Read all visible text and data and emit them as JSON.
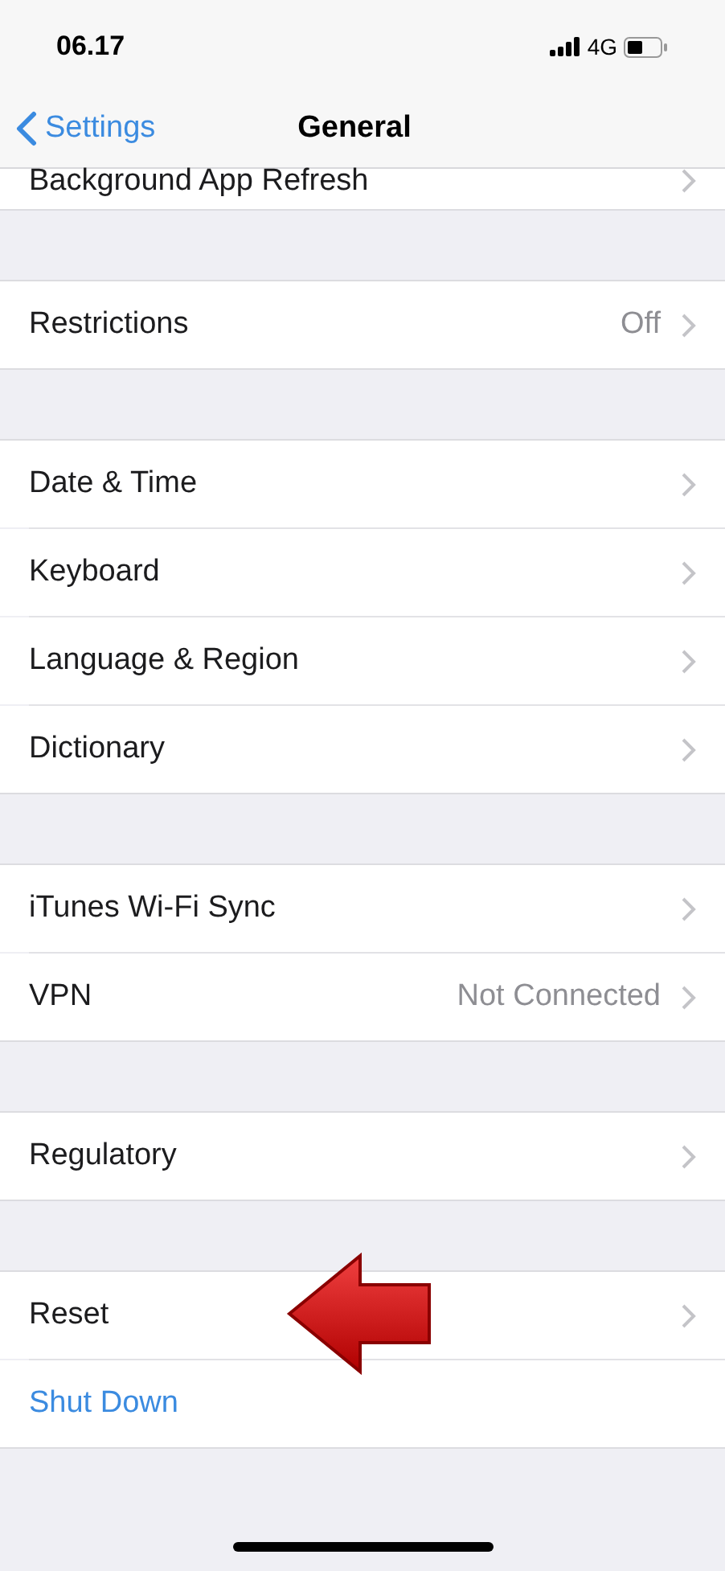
{
  "status_bar": {
    "time": "06.17",
    "network": "4G"
  },
  "nav": {
    "back": "Settings",
    "title": "General"
  },
  "groups": [
    {
      "partial": true,
      "rows": [
        {
          "label": "Background App Refresh",
          "kind": "nav"
        }
      ]
    },
    {
      "rows": [
        {
          "label": "Restrictions",
          "value": "Off",
          "kind": "nav"
        }
      ]
    },
    {
      "rows": [
        {
          "label": "Date & Time",
          "kind": "nav"
        },
        {
          "label": "Keyboard",
          "kind": "nav"
        },
        {
          "label": "Language & Region",
          "kind": "nav"
        },
        {
          "label": "Dictionary",
          "kind": "nav"
        }
      ]
    },
    {
      "rows": [
        {
          "label": "iTunes Wi-Fi Sync",
          "kind": "nav"
        },
        {
          "label": "VPN",
          "value": "Not Connected",
          "kind": "nav"
        }
      ]
    },
    {
      "rows": [
        {
          "label": "Regulatory",
          "kind": "nav"
        }
      ]
    },
    {
      "rows": [
        {
          "label": "Reset",
          "kind": "nav",
          "pointer": true
        },
        {
          "label": "Shut Down",
          "kind": "action"
        }
      ]
    }
  ]
}
